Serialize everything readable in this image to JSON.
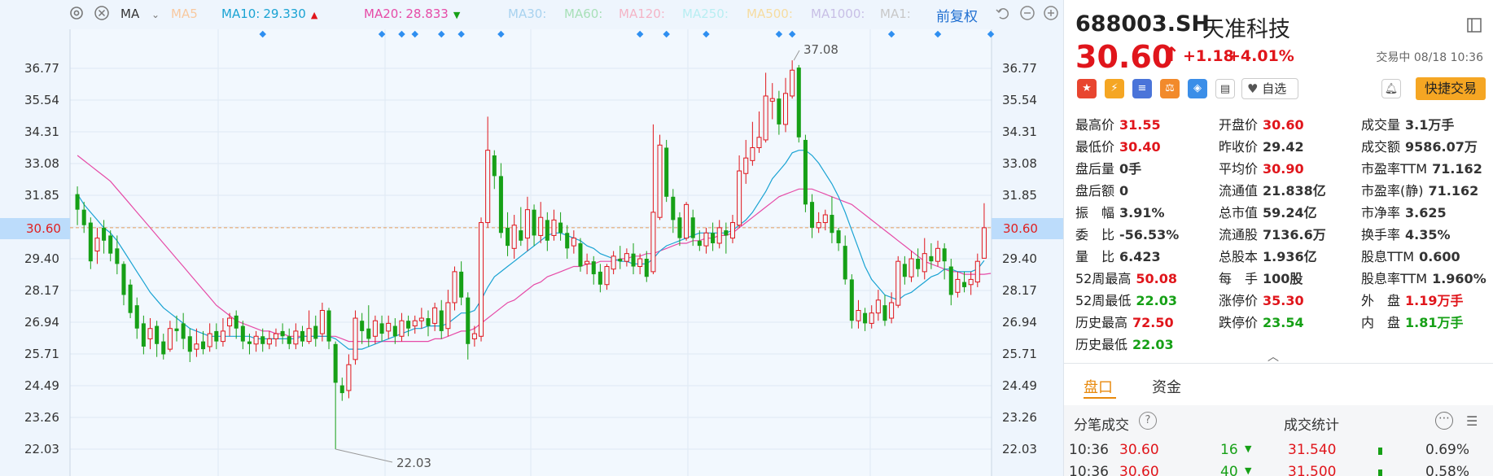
{
  "ma_bar": {
    "ma_label": "MA",
    "items": [
      {
        "label": "MA5",
        "color": "#f8c9a0"
      },
      {
        "label": "MA10:",
        "value": "29.330",
        "color": "#1aa3d3",
        "arrow": "▲",
        "arrow_color": "#e0151b"
      },
      {
        "label": "MA20:",
        "value": "28.833",
        "color": "#e64ba7",
        "arrow": "▼",
        "arrow_color": "#16a016"
      },
      {
        "label": "MA30:",
        "color": "#a8d2ef"
      },
      {
        "label": "MA60:",
        "color": "#a8e0b8"
      },
      {
        "label": "MA120:",
        "color": "#f4b4c6"
      },
      {
        "label": "MA250:",
        "color": "#b8eef2"
      },
      {
        "label": "MA500:",
        "color": "#f6dca0"
      },
      {
        "label": "MA1000:",
        "color": "#c8bfe6"
      },
      {
        "label": "MA1:",
        "color": "#c8c8c8"
      }
    ],
    "adjust_label": "前复权"
  },
  "chart_data": {
    "type": "candlestick",
    "y_ticks": [
      "36.77",
      "35.54",
      "34.31",
      "33.08",
      "31.85",
      "30.60",
      "29.40",
      "28.17",
      "26.94",
      "25.71",
      "24.49",
      "23.26",
      "22.03"
    ],
    "ylim": [
      21.6,
      38.0
    ],
    "current_price": "30.60",
    "high_label": "37.08",
    "low_label": "22.03",
    "candles": [
      [
        31.9,
        31.3,
        32.2,
        30.7
      ],
      [
        31.3,
        30.7,
        31.6,
        30.4
      ],
      [
        30.8,
        29.3,
        31.0,
        29.0
      ],
      [
        29.7,
        30.2,
        30.6,
        29.2
      ],
      [
        30.6,
        30.1,
        30.9,
        29.6
      ],
      [
        30.3,
        29.6,
        30.5,
        29.3
      ],
      [
        29.8,
        29.2,
        30.3,
        28.8
      ],
      [
        29.2,
        28.0,
        29.3,
        27.6
      ],
      [
        28.4,
        27.3,
        28.6,
        27.1
      ],
      [
        27.6,
        26.7,
        27.9,
        26.3
      ],
      [
        26.9,
        26.0,
        27.2,
        25.7
      ],
      [
        26.3,
        26.7,
        27.1,
        25.9
      ],
      [
        26.8,
        26.1,
        27.0,
        25.6
      ],
      [
        26.2,
        25.7,
        26.5,
        25.5
      ],
      [
        25.9,
        26.7,
        27.0,
        25.8
      ],
      [
        26.7,
        26.6,
        27.2,
        26.2
      ],
      [
        26.9,
        26.3,
        27.3,
        25.9
      ],
      [
        26.4,
        25.8,
        26.7,
        25.4
      ],
      [
        25.9,
        26.1,
        26.7,
        25.6
      ],
      [
        26.2,
        25.9,
        26.6,
        25.7
      ],
      [
        26.0,
        26.5,
        26.9,
        25.8
      ],
      [
        26.6,
        26.2,
        26.9,
        25.9
      ],
      [
        26.2,
        26.6,
        27.1,
        26.0
      ],
      [
        26.8,
        27.1,
        27.3,
        26.4
      ],
      [
        27.2,
        26.7,
        27.4,
        26.3
      ],
      [
        26.8,
        26.2,
        27.0,
        25.9
      ],
      [
        26.2,
        26.1,
        26.5,
        25.7
      ],
      [
        26.1,
        26.4,
        26.6,
        25.8
      ],
      [
        26.4,
        26.1,
        26.7,
        25.8
      ],
      [
        26.1,
        26.3,
        26.6,
        25.9
      ],
      [
        26.3,
        26.5,
        26.7,
        26.0
      ],
      [
        26.6,
        26.4,
        26.9,
        26.1
      ],
      [
        26.4,
        26.1,
        26.7,
        25.9
      ],
      [
        26.1,
        26.6,
        26.9,
        25.9
      ],
      [
        26.6,
        26.2,
        26.8,
        26.0
      ],
      [
        26.2,
        26.7,
        27.4,
        26.1
      ],
      [
        26.8,
        26.3,
        27.2,
        26.0
      ],
      [
        26.5,
        27.4,
        27.7,
        26.2
      ],
      [
        27.4,
        26.2,
        27.5,
        25.9
      ],
      [
        26.1,
        24.6,
        26.2,
        22.03
      ],
      [
        24.5,
        24.2,
        24.8,
        23.9
      ],
      [
        24.3,
        25.3,
        25.7,
        24.0
      ],
      [
        25.5,
        27.1,
        27.4,
        25.3
      ],
      [
        27.0,
        26.6,
        27.3,
        26.1
      ],
      [
        26.7,
        26.3,
        27.6,
        26.0
      ],
      [
        26.4,
        27.0,
        27.2,
        26.1
      ],
      [
        26.9,
        26.5,
        27.2,
        26.2
      ],
      [
        26.6,
        26.9,
        27.2,
        26.3
      ],
      [
        26.8,
        26.4,
        27.1,
        26.1
      ],
      [
        26.4,
        27.0,
        27.3,
        26.2
      ],
      [
        27.0,
        26.7,
        27.2,
        26.4
      ],
      [
        26.8,
        27.0,
        27.2,
        26.5
      ],
      [
        27.0,
        27.1,
        27.5,
        26.7
      ],
      [
        27.1,
        26.8,
        27.4,
        26.4
      ],
      [
        26.9,
        27.5,
        27.7,
        26.6
      ],
      [
        27.4,
        26.6,
        27.8,
        26.3
      ],
      [
        26.7,
        27.7,
        28.2,
        26.4
      ],
      [
        27.7,
        28.9,
        29.1,
        27.4
      ],
      [
        28.9,
        27.9,
        29.3,
        27.6
      ],
      [
        27.9,
        26.1,
        28.1,
        25.5
      ],
      [
        26.3,
        26.5,
        26.8,
        26.0
      ],
      [
        26.4,
        30.8,
        31.0,
        26.2
      ],
      [
        30.8,
        33.6,
        34.9,
        30.6
      ],
      [
        33.4,
        32.6,
        33.6,
        32.1
      ],
      [
        32.6,
        30.4,
        33.1,
        30.2
      ],
      [
        30.6,
        29.9,
        31.2,
        29.5
      ],
      [
        29.8,
        30.7,
        31.1,
        29.4
      ],
      [
        30.5,
        30.1,
        31.4,
        29.9
      ],
      [
        30.2,
        31.3,
        31.8,
        29.7
      ],
      [
        31.3,
        30.3,
        31.5,
        29.9
      ],
      [
        30.3,
        31.0,
        31.6,
        30.0
      ],
      [
        30.9,
        30.1,
        31.2,
        29.7
      ],
      [
        30.3,
        30.9,
        31.3,
        30.1
      ],
      [
        30.8,
        30.4,
        31.2,
        30.1
      ],
      [
        30.4,
        29.8,
        30.7,
        29.4
      ],
      [
        29.9,
        30.2,
        30.5,
        29.6
      ],
      [
        30.0,
        29.1,
        30.2,
        28.9
      ],
      [
        29.2,
        29.3,
        29.6,
        28.8
      ],
      [
        29.3,
        28.8,
        29.5,
        28.4
      ],
      [
        28.9,
        28.4,
        29.2,
        28.1
      ],
      [
        28.4,
        29.1,
        29.2,
        28.2
      ],
      [
        29.0,
        29.5,
        29.7,
        28.8
      ],
      [
        29.4,
        29.3,
        29.9,
        29.0
      ],
      [
        29.3,
        29.6,
        29.8,
        29.1
      ],
      [
        29.6,
        29.1,
        30.0,
        28.8
      ],
      [
        29.1,
        29.4,
        29.6,
        28.8
      ],
      [
        29.4,
        28.7,
        29.7,
        28.5
      ],
      [
        28.9,
        31.2,
        34.6,
        28.8
      ],
      [
        31.0,
        33.8,
        34.2,
        30.9
      ],
      [
        33.7,
        31.8,
        34.0,
        31.6
      ],
      [
        31.8,
        30.9,
        32.1,
        30.4
      ],
      [
        31.0,
        30.2,
        31.2,
        29.9
      ],
      [
        30.2,
        31.5,
        31.6,
        30.1
      ],
      [
        31.0,
        30.2,
        31.3,
        29.9
      ],
      [
        30.1,
        29.9,
        30.5,
        29.7
      ],
      [
        29.9,
        30.4,
        30.6,
        29.6
      ],
      [
        30.4,
        30.0,
        30.8,
        29.7
      ],
      [
        30.0,
        30.6,
        30.9,
        29.8
      ],
      [
        30.5,
        30.3,
        30.8,
        29.6
      ],
      [
        30.2,
        30.8,
        31.1,
        30.0
      ],
      [
        30.7,
        32.8,
        33.4,
        30.6
      ],
      [
        32.7,
        33.3,
        34.0,
        32.3
      ],
      [
        33.2,
        33.7,
        34.7,
        33.0
      ],
      [
        33.7,
        34.1,
        35.1,
        33.5
      ],
      [
        34.0,
        35.7,
        36.6,
        33.9
      ],
      [
        35.5,
        35.6,
        36.2,
        34.8
      ],
      [
        35.6,
        34.6,
        35.9,
        34.2
      ],
      [
        34.6,
        35.8,
        36.4,
        34.3
      ],
      [
        35.7,
        36.7,
        37.08,
        35.6
      ],
      [
        36.8,
        34.1,
        36.9,
        33.9
      ],
      [
        34.0,
        31.5,
        34.2,
        31.2
      ],
      [
        31.6,
        30.6,
        31.9,
        30.2
      ],
      [
        30.6,
        30.8,
        31.2,
        30.4
      ],
      [
        30.8,
        31.1,
        31.3,
        30.5
      ],
      [
        31.1,
        30.4,
        31.8,
        30.0
      ],
      [
        30.5,
        30.0,
        30.6,
        29.7
      ],
      [
        29.9,
        28.6,
        30.3,
        28.4
      ],
      [
        28.6,
        27.0,
        28.8,
        26.7
      ],
      [
        27.0,
        27.4,
        27.8,
        26.7
      ],
      [
        27.3,
        26.9,
        27.5,
        26.6
      ],
      [
        26.9,
        27.3,
        27.6,
        26.7
      ],
      [
        27.3,
        27.8,
        28.2,
        27.0
      ],
      [
        27.6,
        27.0,
        28.0,
        26.8
      ],
      [
        27.1,
        27.7,
        28.1,
        26.9
      ],
      [
        27.6,
        29.3,
        29.5,
        27.5
      ],
      [
        29.2,
        28.7,
        29.5,
        28.4
      ],
      [
        28.7,
        29.4,
        29.7,
        28.5
      ],
      [
        29.4,
        29.0,
        29.8,
        28.7
      ],
      [
        28.9,
        29.6,
        30.2,
        28.6
      ],
      [
        29.5,
        29.3,
        30.0,
        29.0
      ],
      [
        29.3,
        29.8,
        30.1,
        29.1
      ],
      [
        29.8,
        29.3,
        30.0,
        28.6
      ],
      [
        29.1,
        28.0,
        29.4,
        27.6
      ],
      [
        28.1,
        28.6,
        28.9,
        27.9
      ],
      [
        28.5,
        28.3,
        28.9,
        28.1
      ],
      [
        28.4,
        28.6,
        28.9,
        28.0
      ],
      [
        28.5,
        29.3,
        29.6,
        28.3
      ],
      [
        29.42,
        30.6,
        31.55,
        30.4
      ]
    ],
    "ma10": [
      31.9,
      31.5,
      31.2,
      30.9,
      30.6,
      30.4,
      30.1,
      29.7,
      29.3,
      28.9,
      28.5,
      28.1,
      27.8,
      27.5,
      27.3,
      27.1,
      26.9,
      26.7,
      26.6,
      26.5,
      26.4,
      26.4,
      26.4,
      26.4,
      26.4,
      26.4,
      26.4,
      26.3,
      26.3,
      26.3,
      26.3,
      26.3,
      26.3,
      26.3,
      26.4,
      26.4,
      26.4,
      26.4,
      26.4,
      26.3,
      26.1,
      25.9,
      25.9,
      25.9,
      26.0,
      26.1,
      26.2,
      26.3,
      26.4,
      26.5,
      26.6,
      26.7,
      26.7,
      26.8,
      26.8,
      26.8,
      26.9,
      27.1,
      27.3,
      27.3,
      27.4,
      27.8,
      28.3,
      28.7,
      28.9,
      29.1,
      29.3,
      29.5,
      29.7,
      29.9,
      30.1,
      30.3,
      30.4,
      30.4,
      30.3,
      30.2,
      30.1,
      29.9,
      29.8,
      29.6,
      29.5,
      29.4,
      29.3,
      29.3,
      29.2,
      29.2,
      29.2,
      29.4,
      29.7,
      29.9,
      30.0,
      30.1,
      30.2,
      30.3,
      30.4,
      30.4,
      30.4,
      30.4,
      30.4,
      30.5,
      30.7,
      30.9,
      31.2,
      31.6,
      32.0,
      32.5,
      32.8,
      33.1,
      33.5,
      33.6,
      33.6,
      33.4,
      33.1,
      32.7,
      32.3,
      31.8,
      31.2,
      30.5,
      29.8,
      29.1,
      28.6,
      28.3,
      28.0,
      27.9,
      27.8,
      28.0,
      28.1,
      28.3,
      28.5,
      28.7,
      28.8,
      29.0,
      29.0,
      28.9,
      28.9,
      28.9,
      29.0,
      29.33
    ],
    "ma20": [
      33.4,
      33.2,
      33.0,
      32.8,
      32.6,
      32.4,
      32.1,
      31.8,
      31.5,
      31.2,
      30.9,
      30.6,
      30.3,
      30.0,
      29.7,
      29.4,
      29.1,
      28.8,
      28.5,
      28.2,
      27.9,
      27.6,
      27.4,
      27.2,
      27.0,
      26.9,
      26.8,
      26.7,
      26.6,
      26.6,
      26.5,
      26.5,
      26.4,
      26.4,
      26.4,
      26.4,
      26.4,
      26.4,
      26.4,
      26.4,
      26.3,
      26.2,
      26.2,
      26.2,
      26.2,
      26.2,
      26.2,
      26.2,
      26.2,
      26.2,
      26.2,
      26.2,
      26.2,
      26.2,
      26.3,
      26.3,
      26.4,
      26.5,
      26.6,
      26.6,
      26.7,
      26.9,
      27.1,
      27.3,
      27.5,
      27.7,
      27.8,
      28.0,
      28.2,
      28.4,
      28.5,
      28.7,
      28.8,
      28.9,
      29.0,
      29.1,
      29.1,
      29.2,
      29.2,
      29.3,
      29.3,
      29.3,
      29.4,
      29.4,
      29.5,
      29.5,
      29.6,
      29.6,
      29.7,
      29.8,
      29.9,
      30.0,
      30.0,
      30.1,
      30.1,
      30.2,
      30.2,
      30.3,
      30.3,
      30.4,
      30.6,
      30.8,
      31.0,
      31.2,
      31.4,
      31.6,
      31.8,
      31.9,
      32.0,
      32.1,
      32.1,
      32.1,
      32.0,
      31.9,
      31.8,
      31.7,
      31.6,
      31.5,
      31.3,
      31.1,
      30.9,
      30.7,
      30.5,
      30.3,
      30.1,
      29.9,
      29.7,
      29.5,
      29.3,
      29.2,
      29.1,
      29.0,
      28.9,
      28.9,
      28.8,
      28.8,
      28.8,
      28.8,
      28.833
    ],
    "markers_count": 15
  },
  "quote": {
    "code": "688003.SH",
    "name": "天准科技",
    "price": "30.60",
    "arrow": "↑",
    "change": "+1.18",
    "change_pct": "+4.01%",
    "status": "交易中 08/18 10:36",
    "watch_label": "自选",
    "fast_trade_label": "快捷交易",
    "fields": [
      [
        {
          "label": "最高价",
          "value": "31.55",
          "color": "red"
        },
        {
          "label": "开盘价",
          "value": "30.60",
          "color": "red"
        },
        {
          "label": "成交量",
          "value": "3.1万手",
          "color": "grey"
        }
      ],
      [
        {
          "label": "最低价",
          "value": "30.40",
          "color": "red"
        },
        {
          "label": "昨收价",
          "value": "29.42",
          "color": "grey"
        },
        {
          "label": "成交额",
          "value": "9586.07万",
          "color": "grey"
        }
      ],
      [
        {
          "label": "盘后量",
          "value": "0手",
          "color": "grey"
        },
        {
          "label": "平均价",
          "value": "30.90",
          "color": "red"
        },
        {
          "label": "市盈率TTM",
          "value": "71.162",
          "color": "grey"
        }
      ],
      [
        {
          "label": "盘后额",
          "value": "0",
          "color": "grey"
        },
        {
          "label": "流通值",
          "value": "21.838亿",
          "color": "grey"
        },
        {
          "label": "市盈率(静)",
          "value": "71.162",
          "color": "grey"
        }
      ],
      [
        {
          "label": "振　幅",
          "value": "3.91%",
          "color": "grey"
        },
        {
          "label": "总市值",
          "value": "59.24亿",
          "color": "grey"
        },
        {
          "label": "市净率",
          "value": "3.625",
          "color": "grey"
        }
      ],
      [
        {
          "label": "委　比",
          "value": "-56.53%",
          "color": "grey"
        },
        {
          "label": "流通股",
          "value": "7136.6万",
          "color": "grey"
        },
        {
          "label": "换手率",
          "value": "4.35%",
          "color": "grey"
        }
      ],
      [
        {
          "label": "量　比",
          "value": "6.423",
          "color": "grey"
        },
        {
          "label": "总股本",
          "value": "1.936亿",
          "color": "grey"
        },
        {
          "label": "股息TTM",
          "value": "0.600",
          "color": "grey"
        }
      ],
      [
        {
          "label": "52周最高",
          "value": "50.08",
          "color": "red"
        },
        {
          "label": "每　手",
          "value": "100股",
          "color": "grey"
        },
        {
          "label": "股息率TTM",
          "value": "1.960%",
          "color": "grey"
        }
      ],
      [
        {
          "label": "52周最低",
          "value": "22.03",
          "color": "green"
        },
        {
          "label": "涨停价",
          "value": "35.30",
          "color": "red"
        },
        {
          "label": "外　盘",
          "value": "1.19万手",
          "color": "red"
        }
      ],
      [
        {
          "label": "历史最高",
          "value": "72.50",
          "color": "red"
        },
        {
          "label": "跌停价",
          "value": "23.54",
          "color": "green"
        },
        {
          "label": "内　盘",
          "value": "1.81万手",
          "color": "green"
        }
      ],
      [
        {
          "label": "历史最低",
          "value": "22.03",
          "color": "green"
        }
      ]
    ],
    "tabs": [
      "盘口",
      "资金"
    ],
    "trade_title": "分笔成交",
    "stats_title": "成交统计",
    "trades": [
      {
        "time": "10:36",
        "price": "30.60",
        "vol": "16",
        "stat_price": "31.540",
        "stat_pct": "0.69%"
      },
      {
        "time": "10:36",
        "price": "30.60",
        "vol": "40",
        "stat_price": "31.500",
        "stat_pct": "0.58%"
      }
    ]
  }
}
